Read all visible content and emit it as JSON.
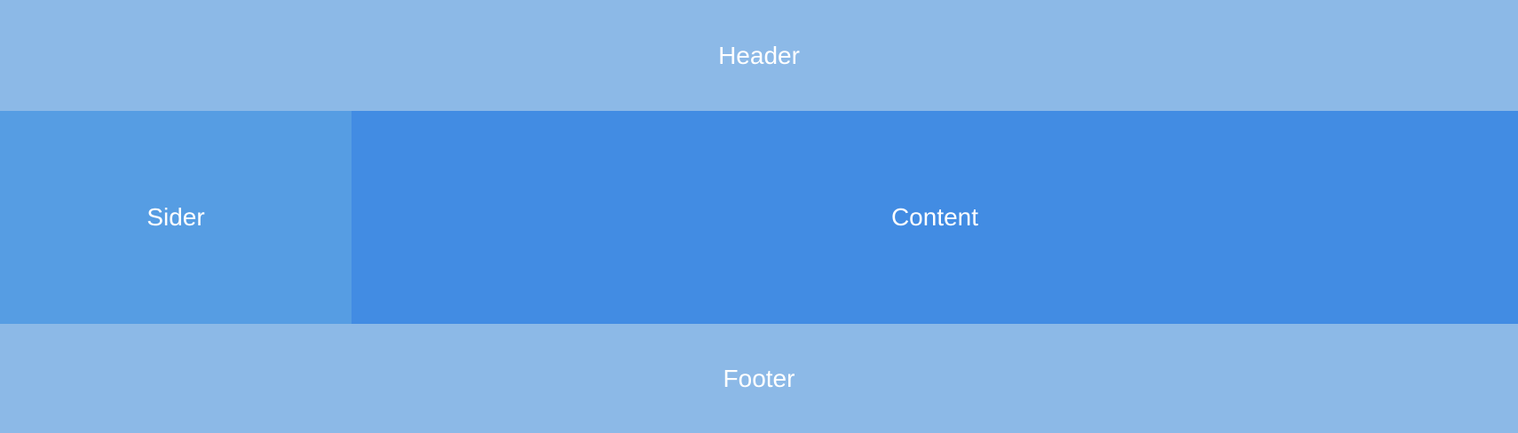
{
  "layout": {
    "header_label": "Header",
    "sider_label": "Sider",
    "content_label": "Content",
    "footer_label": "Footer"
  },
  "colors": {
    "header_footer_bg": "#8CB9E7",
    "sider_bg": "#569DE3",
    "content_bg": "#428CE3",
    "text": "#FFFFFF"
  }
}
